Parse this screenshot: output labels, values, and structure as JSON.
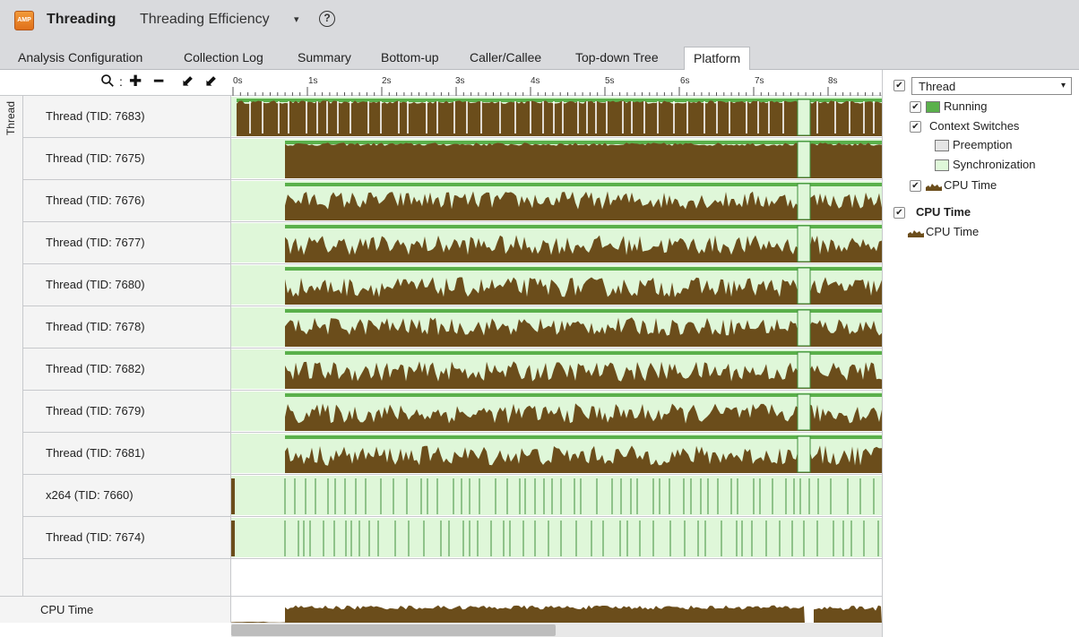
{
  "colors": {
    "running": "#5ab04b",
    "cpu_time": "#6b4d1b",
    "synchronization": "#dff7d9",
    "sync_border": "#3f8f3b",
    "preemption": "#e4e4e4"
  },
  "header": {
    "app_icon_text": "AMP",
    "app_title": "Threading",
    "analysis_name": "Threading Efficiency",
    "dropdown_icon": "▾",
    "help_icon": "?"
  },
  "tabs": [
    {
      "label": "Analysis Configuration"
    },
    {
      "label": "Collection Log"
    },
    {
      "label": "Summary"
    },
    {
      "label": "Bottom-up"
    },
    {
      "label": "Caller/Callee"
    },
    {
      "label": "Top-down Tree"
    },
    {
      "label": "Platform",
      "active": true
    }
  ],
  "toolbar": {
    "zoom_icon": "⚲",
    "separator": ":",
    "zoom_in_icon": "✚",
    "zoom_out_icon": "━",
    "zoom_back_icon": "⬋",
    "zoom_reset_icon": "⬋"
  },
  "ruler": {
    "labels": [
      "0s",
      "1s",
      "2s",
      "3s",
      "4s",
      "5s",
      "6s",
      "7s",
      "8s"
    ]
  },
  "gutter": {
    "label": "Thread"
  },
  "threads": [
    {
      "label": "Thread (TID: 7683)",
      "kind": "full"
    },
    {
      "label": "Thread (TID: 7675)",
      "kind": "solid"
    },
    {
      "label": "Thread (TID: 7676)",
      "kind": "mixed"
    },
    {
      "label": "Thread (TID: 7677)",
      "kind": "spiky"
    },
    {
      "label": "Thread (TID: 7680)",
      "kind": "spiky"
    },
    {
      "label": "Thread (TID: 7678)",
      "kind": "mixed"
    },
    {
      "label": "Thread (TID: 7682)",
      "kind": "spiky"
    },
    {
      "label": "Thread (TID: 7679)",
      "kind": "spiky"
    },
    {
      "label": "Thread (TID: 7681)",
      "kind": "spiky"
    },
    {
      "label": "x264 (TID: 7660)",
      "kind": "sync"
    },
    {
      "label": "Thread (TID: 7674)",
      "kind": "sync"
    }
  ],
  "cpu_overview": {
    "label": "CPU Time"
  },
  "legend": {
    "group_select": "Thread",
    "select_arrow": "▾",
    "items": {
      "running": "Running",
      "context_switches": "Context Switches",
      "preemption": "Preemption",
      "synchronization": "Synchronization",
      "cpu_time": "CPU Time"
    },
    "cpu_section_title": "CPU Time",
    "cpu_section_item": "CPU Time",
    "check_mark": "✔"
  }
}
